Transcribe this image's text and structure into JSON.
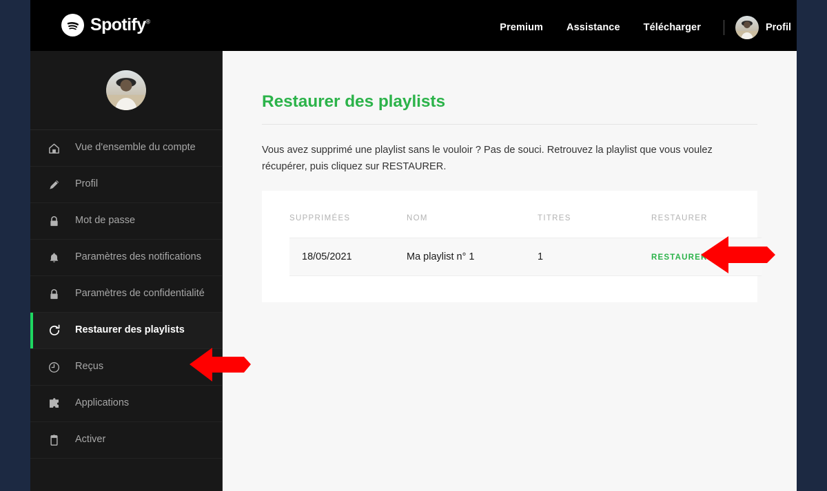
{
  "brand": {
    "name": "Spotify",
    "registered_mark": "®",
    "accent_green": "#1ed760",
    "text_green": "#2cb34a",
    "nav_background": "#000000",
    "sidebar_background": "#181818",
    "content_background": "#f7f7f7",
    "desktop_background": "#1c2942",
    "annotation_arrow_color": "#ff0000"
  },
  "topnav": {
    "logo_label": "Spotify",
    "links": [
      {
        "label": "Premium"
      },
      {
        "label": "Assistance"
      },
      {
        "label": "Télécharger"
      }
    ],
    "profile_label": "Profil"
  },
  "sidebar": {
    "items": [
      {
        "label": "Vue d'ensemble du compte",
        "icon": "home-icon",
        "active": false
      },
      {
        "label": "Profil",
        "icon": "pencil-icon",
        "active": false
      },
      {
        "label": "Mot de passe",
        "icon": "lock-icon",
        "active": false
      },
      {
        "label": "Paramètres des notifications",
        "icon": "bell-icon",
        "active": false
      },
      {
        "label": "Paramètres de confidentialité",
        "icon": "lock-icon",
        "active": false
      },
      {
        "label": "Restaurer des playlists",
        "icon": "restore-icon",
        "active": true
      },
      {
        "label": "Reçus",
        "icon": "clock-icon",
        "active": false
      },
      {
        "label": "Applications",
        "icon": "puzzle-icon",
        "active": false
      },
      {
        "label": "Activer",
        "icon": "device-icon",
        "active": false
      }
    ]
  },
  "main": {
    "title": "Restaurer des playlists",
    "intro": "Vous avez supprimé une playlist sans le vouloir ? Pas de souci. Retrouvez la playlist que vous voulez récupérer, puis cliquez sur RESTAURER.",
    "table": {
      "columns": [
        "SUPPRIMÉES",
        "NOM",
        "TITRES",
        "RESTAURER"
      ],
      "rows": [
        {
          "deleted_on": "18/05/2021",
          "name": "Ma playlist n° 1",
          "tracks": "1",
          "action_label": "RESTAURER"
        }
      ]
    }
  }
}
